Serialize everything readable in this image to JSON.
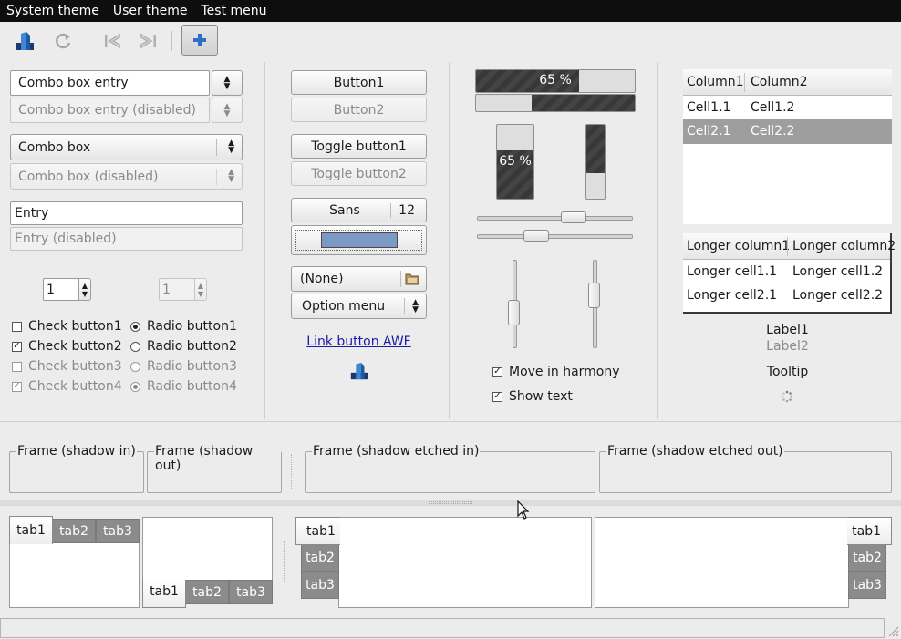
{
  "menubar": {
    "items": [
      "System theme",
      "User theme",
      "Test menu"
    ]
  },
  "toolbar": {
    "icons": [
      "awf-logo-icon",
      "refresh-icon",
      "first-page-icon",
      "last-page-icon",
      "add-icon"
    ]
  },
  "col1": {
    "combo_entry": "Combo box entry",
    "combo_entry_disabled": "Combo box entry (disabled)",
    "combo": "Combo box",
    "combo_disabled": "Combo box (disabled)",
    "entry": "Entry",
    "entry_disabled": "Entry (disabled)",
    "spin1": "1",
    "spin2": "1",
    "check1": "Check button1",
    "check2": "Check button2",
    "check3": "Check button3",
    "check4": "Check button4",
    "radio1": "Radio button1",
    "radio2": "Radio button2",
    "radio3": "Radio button3",
    "radio4": "Radio button4",
    "checkmark": "✓"
  },
  "col2": {
    "button1": "Button1",
    "button2": "Button2",
    "toggle1": "Toggle button1",
    "toggle2": "Toggle button2",
    "font_name": "Sans",
    "font_size": "12",
    "color_value": "#7c99c6",
    "file_chooser": "(None)",
    "option_menu": "Option menu",
    "link": "Link button AWF"
  },
  "col3": {
    "progress_h1": "65 %",
    "progress_h1_fraction": 0.65,
    "progress_h2_fraction": 0.65,
    "progress_v1": "65 %",
    "progress_v1_fraction": 0.65,
    "progress_v2_fraction": 0.65,
    "hscale1_value": 0.62,
    "hscale2_value": 0.38,
    "vscale1_value": 0.6,
    "vscale2_value": 0.4,
    "check_harmony": "Move in harmony",
    "check_show_text": "Show text"
  },
  "col4": {
    "tree1": {
      "headers": [
        "Column1",
        "Column2"
      ],
      "rows": [
        [
          "Cell1.1",
          "Cell1.2"
        ],
        [
          "Cell2.1",
          "Cell2.2"
        ]
      ]
    },
    "tree2": {
      "headers": [
        "Longer column1",
        "Longer column2"
      ],
      "rows": [
        [
          "Longer cell1.1",
          "Longer cell1.2"
        ],
        [
          "Longer cell2.1",
          "Longer cell2.2"
        ]
      ]
    },
    "label1": "Label1",
    "label2": "Label2",
    "tooltip": "Tooltip"
  },
  "frames": {
    "shadow_in": "Frame (shadow in)",
    "shadow_out": "Frame (shadow out)",
    "etched_in": "Frame (shadow etched in)",
    "etched_out": "Frame (shadow etched out)"
  },
  "notebooks": {
    "tabs": [
      "tab1",
      "tab2",
      "tab3"
    ]
  },
  "colors": {
    "menubar_bg": "#0e0e0e",
    "progress_fill": "#3a3a3a",
    "selection": "#9e9e9e",
    "tab_inactive": "#8b8b8b",
    "link": "#1a1aa6"
  }
}
